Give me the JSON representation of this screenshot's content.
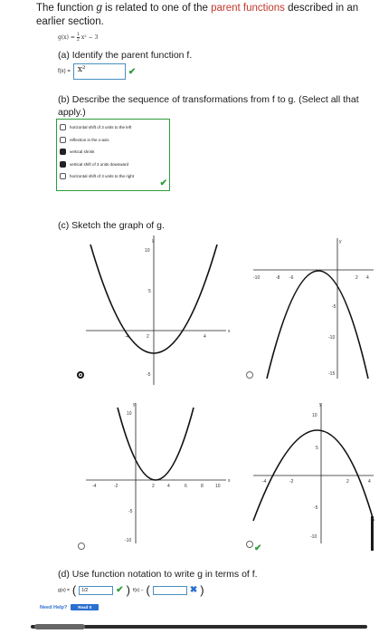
{
  "intro": {
    "before": "The function ",
    "g": "g",
    "middle": " is related to one of the ",
    "link": "parent functions",
    "after": " described in an earlier section."
  },
  "gx_definition": {
    "lhs": "g(x) = ",
    "num": "1",
    "den": "2",
    "rest": "x² − 3"
  },
  "part_a": {
    "prompt": "(a) Identify the parent function f.",
    "label": "f(x) = ",
    "answer": "x²",
    "status": "correct"
  },
  "part_b": {
    "prompt": "(b) Describe the sequence of transformations from f to g. (Select all that apply.)",
    "options": [
      {
        "label": "horizontal shift of 3 units to the left",
        "checked": false
      },
      {
        "label": "reflection in the x-axis",
        "checked": false
      },
      {
        "label": "vertical shrink",
        "checked": true
      },
      {
        "label": "vertical shift of 3 units downward",
        "checked": true
      },
      {
        "label": "horizontal shift of 3 units to the right",
        "checked": false
      }
    ],
    "status": "correct"
  },
  "part_c": {
    "prompt": "(c) Sketch the graph of g.",
    "graphs": [
      {
        "id": "A",
        "selected": true,
        "axis_x": "x",
        "axis_y": "y",
        "x_ticks": [
          "-4",
          "2",
          "4"
        ],
        "y_ticks": [
          "10",
          "5",
          "-5"
        ]
      },
      {
        "id": "B",
        "selected": false,
        "axis_x": "x",
        "axis_y": "y",
        "x_ticks": [
          "-10",
          "-8",
          "-6",
          "2",
          "4"
        ],
        "y_ticks": [
          "-5",
          "-10",
          "-15"
        ]
      },
      {
        "id": "C",
        "selected": false,
        "axis_x": "x",
        "axis_y": "y",
        "x_ticks": [
          "-4",
          "-2",
          "2",
          "4",
          "6",
          "8",
          "10"
        ],
        "y_ticks": [
          "10",
          "-5",
          "-10"
        ]
      },
      {
        "id": "D",
        "selected": false,
        "axis_x": "x",
        "axis_y": "y",
        "x_ticks": [
          "-4",
          "-2",
          "2",
          "4"
        ],
        "y_ticks": [
          "10",
          "5",
          "-5",
          "-10"
        ]
      }
    ],
    "status": "correct"
  },
  "part_d": {
    "prompt": "(d) Use function notation to write g in terms of f.",
    "label": "g(x) = ",
    "coef": "1/2",
    "coef_status": "correct",
    "f_label": "f(x) − ",
    "const": "",
    "const_status": "incorrect"
  },
  "help": {
    "label": "Need Help?",
    "button": "Read It"
  },
  "colors": {
    "link": "#c0392b",
    "correct": "#2e9c3a",
    "incorrect": "#2a6fd1",
    "border": "#4a90c2"
  }
}
